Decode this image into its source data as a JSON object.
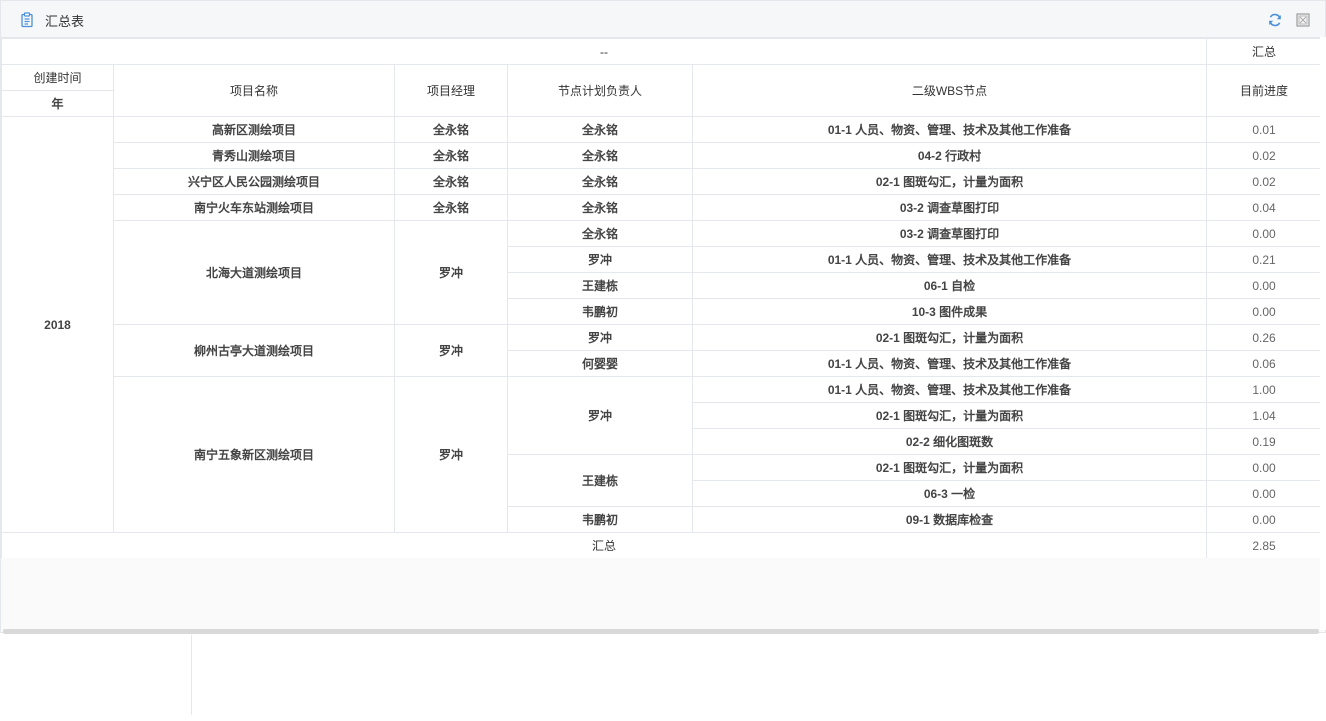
{
  "panel": {
    "title": "汇总表",
    "title_icon": "clipboard-icon",
    "refresh_icon": "refresh-icon",
    "maximize_icon": "maximize-icon"
  },
  "colors": {
    "border": "#e4e7eb",
    "header_bg": "#f6f7f9",
    "icon_blue": "#4a90d9"
  },
  "table": {
    "top_header_left": "--",
    "top_header_right": "汇总",
    "headers": {
      "created": "创建时间",
      "year": "年",
      "project": "项目名称",
      "manager": "项目经理",
      "owner": "节点计划负责人",
      "wbs": "二级WBS节点",
      "progress": "目前进度"
    },
    "year_value": "2018",
    "projects": [
      {
        "name": "高新区测绘项目",
        "manager": "全永铭",
        "owners": [
          {
            "name": "全永铭",
            "nodes": [
              {
                "wbs": "01-1 人员、物资、管理、技术及其他工作准备",
                "progress": "0.01"
              }
            ]
          }
        ]
      },
      {
        "name": "青秀山测绘项目",
        "manager": "全永铭",
        "owners": [
          {
            "name": "全永铭",
            "nodes": [
              {
                "wbs": "04-2 行政村",
                "progress": "0.02"
              }
            ]
          }
        ]
      },
      {
        "name": "兴宁区人民公园测绘项目",
        "manager": "全永铭",
        "owners": [
          {
            "name": "全永铭",
            "nodes": [
              {
                "wbs": "02-1 图斑勾汇，计量为面积",
                "progress": "0.02"
              }
            ]
          }
        ]
      },
      {
        "name": "南宁火车东站测绘项目",
        "manager": "全永铭",
        "owners": [
          {
            "name": "全永铭",
            "nodes": [
              {
                "wbs": "03-2 调查草图打印",
                "progress": "0.04"
              }
            ]
          }
        ]
      },
      {
        "name": "北海大道测绘项目",
        "manager": "罗冲",
        "owners": [
          {
            "name": "全永铭",
            "nodes": [
              {
                "wbs": "03-2 调查草图打印",
                "progress": "0.00"
              }
            ]
          },
          {
            "name": "罗冲",
            "nodes": [
              {
                "wbs": "01-1 人员、物资、管理、技术及其他工作准备",
                "progress": "0.21"
              }
            ]
          },
          {
            "name": "王建栋",
            "nodes": [
              {
                "wbs": "06-1 自检",
                "progress": "0.00"
              }
            ]
          },
          {
            "name": "韦鹏初",
            "nodes": [
              {
                "wbs": "10-3 图件成果",
                "progress": "0.00"
              }
            ]
          }
        ]
      },
      {
        "name": "柳州古亭大道测绘项目",
        "manager": "罗冲",
        "owners": [
          {
            "name": "罗冲",
            "nodes": [
              {
                "wbs": "02-1 图斑勾汇，计量为面积",
                "progress": "0.26"
              }
            ]
          },
          {
            "name": "何婴婴",
            "nodes": [
              {
                "wbs": "01-1 人员、物资、管理、技术及其他工作准备",
                "progress": "0.06"
              }
            ]
          }
        ]
      },
      {
        "name": "南宁五象新区测绘项目",
        "manager": "罗冲",
        "owners": [
          {
            "name": "罗冲",
            "nodes": [
              {
                "wbs": "01-1 人员、物资、管理、技术及其他工作准备",
                "progress": "1.00"
              },
              {
                "wbs": "02-1 图斑勾汇，计量为面积",
                "progress": "1.04"
              },
              {
                "wbs": "02-2 细化图斑数",
                "progress": "0.19"
              }
            ]
          },
          {
            "name": "王建栋",
            "nodes": [
              {
                "wbs": "02-1 图斑勾汇，计量为面积",
                "progress": "0.00"
              },
              {
                "wbs": "06-3 一检",
                "progress": "0.00"
              }
            ]
          },
          {
            "name": "韦鹏初",
            "nodes": [
              {
                "wbs": "09-1 数据库检查",
                "progress": "0.00"
              }
            ]
          }
        ]
      }
    ],
    "total_label": "汇总",
    "total_value": "2.85"
  }
}
